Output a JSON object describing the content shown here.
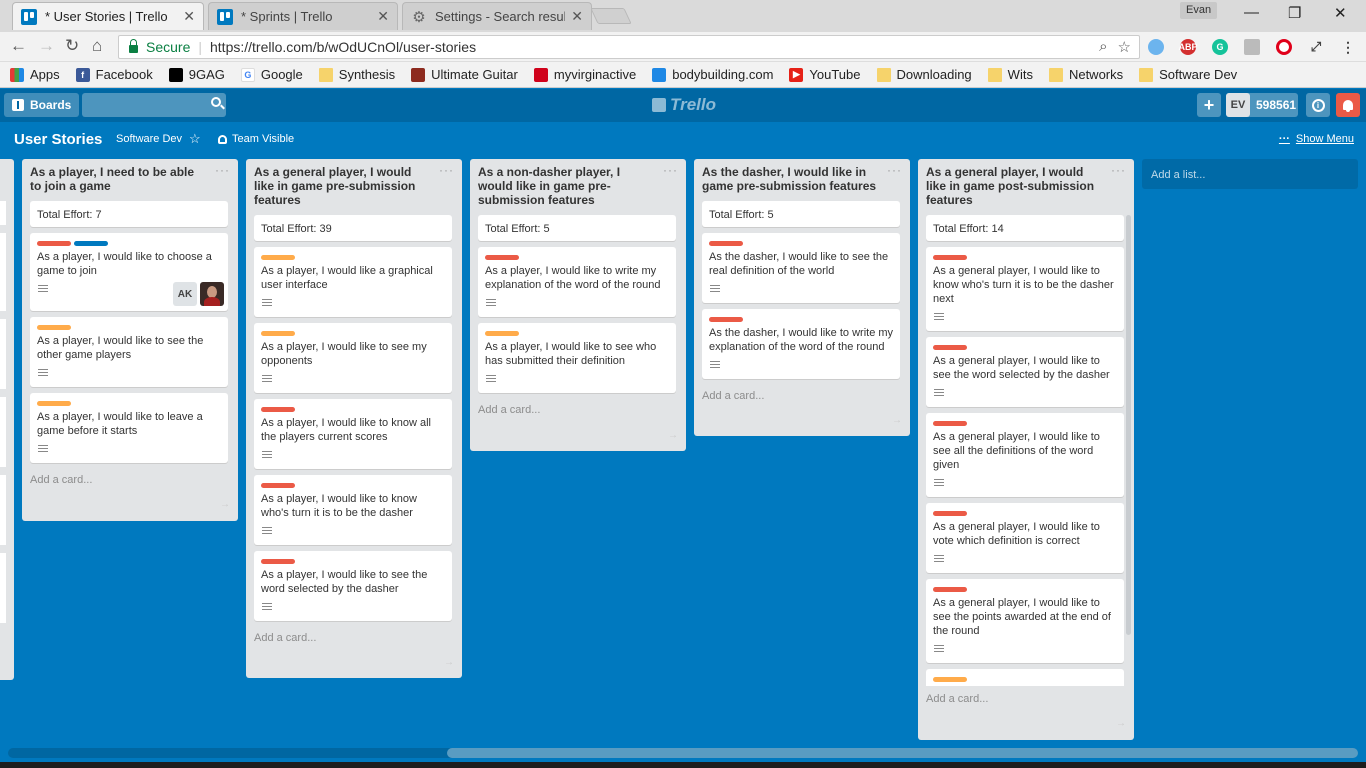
{
  "browser": {
    "tabs": [
      {
        "title": "* User Stories | Trello",
        "icon": "trello-icon"
      },
      {
        "title": "* Sprints | Trello",
        "icon": "trello-icon"
      },
      {
        "title": "Settings - Search results",
        "icon": "gear-icon"
      }
    ],
    "profile_name": "Evan",
    "secure_label": "Secure",
    "url": "https://trello.com/b/wOdUCnOl/user-stories",
    "bookmarks": [
      "Apps",
      "Facebook",
      "9GAG",
      "Google",
      "Synthesis",
      "Ultimate Guitar",
      "myvirginactive",
      "bodybuilding.com",
      "YouTube",
      "Downloading",
      "Wits",
      "Networks",
      "Software Dev"
    ],
    "extensions": [
      "onedrive-icon",
      "adblock-plus-icon",
      "grammarly-icon",
      "pdf-icon",
      "opera-icon",
      "expand-icon"
    ],
    "extension_labels": {
      "abp": "ABP",
      "grammarly": "G"
    }
  },
  "trello": {
    "boards_label": "Boards",
    "logo_text": "Trello",
    "member_initials": "EV",
    "member_points": "598561",
    "add_icon": "+"
  },
  "board": {
    "title": "User Stories",
    "team": "Software Dev",
    "visibility": "Team Visible",
    "show_menu": "Show Menu"
  },
  "lists": [
    {
      "name": "As a player, I need to be able to join a game",
      "cards": [
        {
          "text": "Total Effort: 7"
        },
        {
          "labels": [
            "red",
            "blue"
          ],
          "text": "As a player, I would like to choose a game to join",
          "members": [
            "AK",
            "photo"
          ]
        },
        {
          "labels": [
            "orange"
          ],
          "text": "As a player, I would like to see the other game players"
        },
        {
          "labels": [
            "orange"
          ],
          "text": "As a player, I would like to leave a game before it starts"
        }
      ],
      "add_card": "Add a card..."
    },
    {
      "name": "As a general player, I would like in game pre-submission features",
      "cards": [
        {
          "text": "Total Effort: 39"
        },
        {
          "labels": [
            "orange"
          ],
          "text": "As a player, I would like a graphical user interface"
        },
        {
          "labels": [
            "orange"
          ],
          "text": "As a player, I would like to see my opponents"
        },
        {
          "labels": [
            "red"
          ],
          "text": "As a player, I would like to know all the players current scores"
        },
        {
          "labels": [
            "red"
          ],
          "text": "As a player, I would like to know who's turn it is to be the dasher"
        },
        {
          "labels": [
            "red"
          ],
          "text": "As a player, I would like to see the word selected by the dasher"
        }
      ],
      "add_card": "Add a card..."
    },
    {
      "name": "As a non-dasher player, I would like in game pre-submission features",
      "cards": [
        {
          "text": "Total Effort: 5"
        },
        {
          "labels": [
            "red"
          ],
          "text": "As a player, I would like to write my explanation of the word of the round"
        },
        {
          "labels": [
            "orange"
          ],
          "text": "As a player, I would like to see who has submitted their definition"
        }
      ],
      "add_card": "Add a card..."
    },
    {
      "name": "As the dasher, I would like in game pre-submission features",
      "cards": [
        {
          "text": "Total Effort: 5"
        },
        {
          "labels": [
            "red"
          ],
          "text": "As the dasher, I would like to see the real definition of the world"
        },
        {
          "labels": [
            "red"
          ],
          "text": "As the dasher, I would like to write my explanation of the word of the round"
        }
      ],
      "add_card": "Add a card..."
    },
    {
      "name": "As a general player, I would like in game post-submission features",
      "cards": [
        {
          "text": "Total Effort: 14"
        },
        {
          "labels": [
            "red"
          ],
          "text": "As a general player, I would like to know who's turn it is to be the dasher next"
        },
        {
          "labels": [
            "red"
          ],
          "text": "As a general player, I would like to see the word selected by the dasher"
        },
        {
          "labels": [
            "red"
          ],
          "text": "As a general player, I would like to see all the definitions of the word given"
        },
        {
          "labels": [
            "red"
          ],
          "text": "As a general player, I would like to vote which definition is correct"
        },
        {
          "labels": [
            "red"
          ],
          "text": "As a general player, I would like to see the points awarded at the end of the round"
        },
        {
          "labels": [
            "orange"
          ],
          "text": ""
        }
      ],
      "add_card": "Add a card..."
    }
  ],
  "add_list": "Add a list...",
  "colors": {
    "board_bg": "#0079bf",
    "header_bg": "#0067a3",
    "label_red": "#eb5a46",
    "label_orange": "#ffab4a",
    "label_blue": "#0079bf",
    "notification": "#eb5a46"
  }
}
